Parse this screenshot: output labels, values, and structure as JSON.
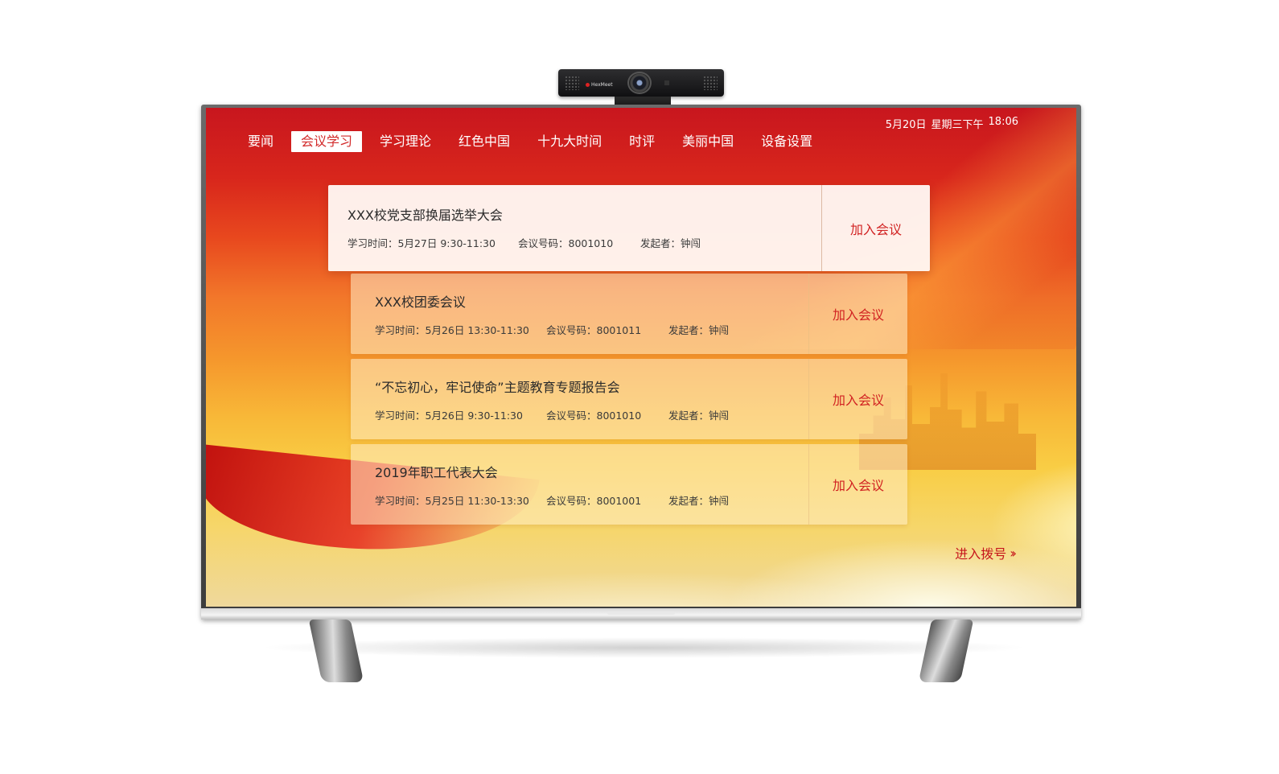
{
  "device": {
    "camera_brand": "HexMeet"
  },
  "status": {
    "date": "5月20日",
    "weekday_time": "星期三下午",
    "time": "18:06"
  },
  "nav": {
    "items": [
      {
        "label": "要闻",
        "active": false
      },
      {
        "label": "会议学习",
        "active": true
      },
      {
        "label": "学习理论",
        "active": false
      },
      {
        "label": "红色中国",
        "active": false
      },
      {
        "label": "十九大时间",
        "active": false
      },
      {
        "label": "时评",
        "active": false
      },
      {
        "label": "美丽中国",
        "active": false
      },
      {
        "label": "设备设置",
        "active": false
      }
    ]
  },
  "meetings": [
    {
      "title": "XXX校党支部换届选举大会",
      "time": "学习时间：5月27日 9:30-11:30",
      "code": "会议号码：8001010",
      "host": "发起者：钟闯",
      "action": "加入会议"
    },
    {
      "title": "XXX校团委会议",
      "time": "学习时间：5月26日 13:30-11:30",
      "code": "会议号码：8001011",
      "host": "发起者：钟闯",
      "action": "加入会议"
    },
    {
      "title": "“不忘初心，牢记使命”主题教育专题报告会",
      "time": "学习时间：5月26日 9:30-11:30",
      "code": "会议号码：8001010",
      "host": "发起者：钟闯",
      "action": "加入会议"
    },
    {
      "title": "2019年职工代表大会",
      "time": "学习时间：5月25日 11:30-13:30",
      "code": "会议号码：8001001",
      "host": "发起者：钟闯",
      "action": "加入会议"
    }
  ],
  "dial": {
    "label": "进入拨号",
    "icon": "double-chevron-right-icon",
    "color": "#c6161c"
  },
  "colors": {
    "accent": "#d12222",
    "active_nav_bg": "#ffffff"
  }
}
